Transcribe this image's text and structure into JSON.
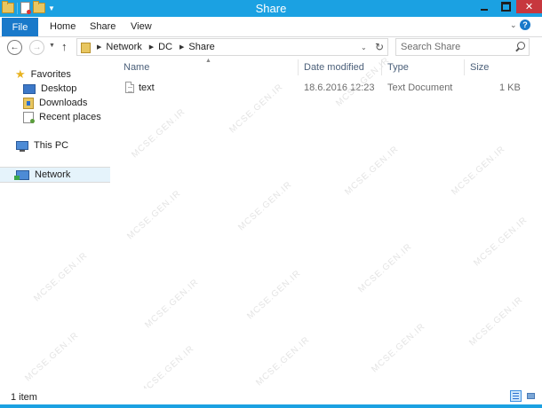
{
  "window": {
    "title": "Share",
    "controls": {
      "minimize": "minimize-icon",
      "maximize": "maximize-icon",
      "close": "✕"
    }
  },
  "ribbon": {
    "tabs": [
      "File",
      "Home",
      "Share",
      "View"
    ],
    "help": "?"
  },
  "address": {
    "crumbs": [
      "Network",
      "DC",
      "Share"
    ],
    "search_placeholder": "Search Share"
  },
  "navigation": {
    "favorites": "Favorites",
    "favorites_items": [
      "Desktop",
      "Downloads",
      "Recent places"
    ],
    "this_pc": "This PC",
    "network": "Network"
  },
  "columns": [
    "Name",
    "Date modified",
    "Type",
    "Size"
  ],
  "files": [
    {
      "name": "text",
      "date_modified": "18.6.2016 12:23",
      "type": "Text Document",
      "size": "1 KB"
    }
  ],
  "status": {
    "item_count": "1 item"
  },
  "watermark": "MCSE.GEN.IR",
  "colors": {
    "title_bar": "#1ba1e2",
    "file_tab": "#1979ca",
    "close_button": "#c7373e",
    "selection": "#e5f3fb"
  }
}
